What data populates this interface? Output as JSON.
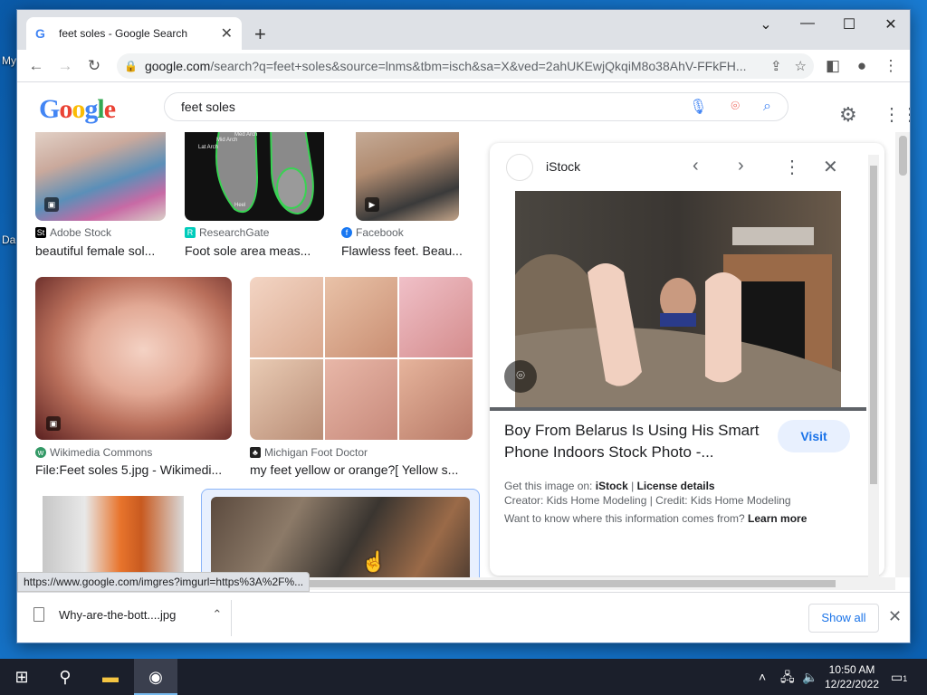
{
  "desktop": {
    "label_top": "My",
    "label_bottom": "Da"
  },
  "browser": {
    "tab_title": "feet soles - Google Search",
    "new_tab_symbol": "+",
    "url_host": "google.com",
    "url_rest": "/search?q=feet+soles&source=lnms&tbm=isch&sa=X&ved=2ahUKEwjQkqiM8o38AhV-FFkFH...",
    "status_url": "https://www.google.com/imgres?imgurl=https%3A%2F%..."
  },
  "google": {
    "logo_letters": [
      "G",
      "o",
      "o",
      "g",
      "l",
      "e"
    ],
    "logo_colors": [
      "#4285f4",
      "#ea4335",
      "#fbbc05",
      "#4285f4",
      "#34a853",
      "#ea4335"
    ],
    "query": "feet soles"
  },
  "results": [
    {
      "source": "Adobe Stock",
      "caption": "beautiful female sol...",
      "icon_color": "#000000"
    },
    {
      "source": "ResearchGate",
      "caption": "Foot sole area meas...",
      "icon_color": "#00ccbb"
    },
    {
      "source": "Facebook",
      "caption": "Flawless feet. Beau...",
      "icon_color": "#1877f2"
    },
    {
      "source": "Wikimedia Commons",
      "caption": "File:Feet soles 5.jpg - Wikimedi...",
      "icon_color": "#339966"
    },
    {
      "source": "Michigan Foot Doctor",
      "caption": "my feet yellow or orange?[ Yellow s...",
      "icon_color": "#222222"
    }
  ],
  "diagram_labels": {
    "lat": "Lat Arch",
    "mid": "Mid Arch",
    "med": "Med Arch",
    "heel": "Heel"
  },
  "panel": {
    "site": "iStock",
    "title": "Boy From Belarus Is Using His Smart Phone Indoors Stock Photo -...",
    "visit_label": "Visit",
    "get_image_prefix": "Get this image on:",
    "get_image_site": "iStock",
    "separator": "|",
    "license": "License details",
    "creator": "Creator: Kids Home Modeling | Credit: Kids Home Modeling",
    "info_question": "Want to know where this information comes from?",
    "learn_more": "Learn more"
  },
  "downloads": {
    "file": "Why-are-the-bott....jpg",
    "show_all": "Show all"
  },
  "taskbar": {
    "time": "10:50 AM",
    "date": "12/22/2022",
    "notification_count": "1"
  }
}
